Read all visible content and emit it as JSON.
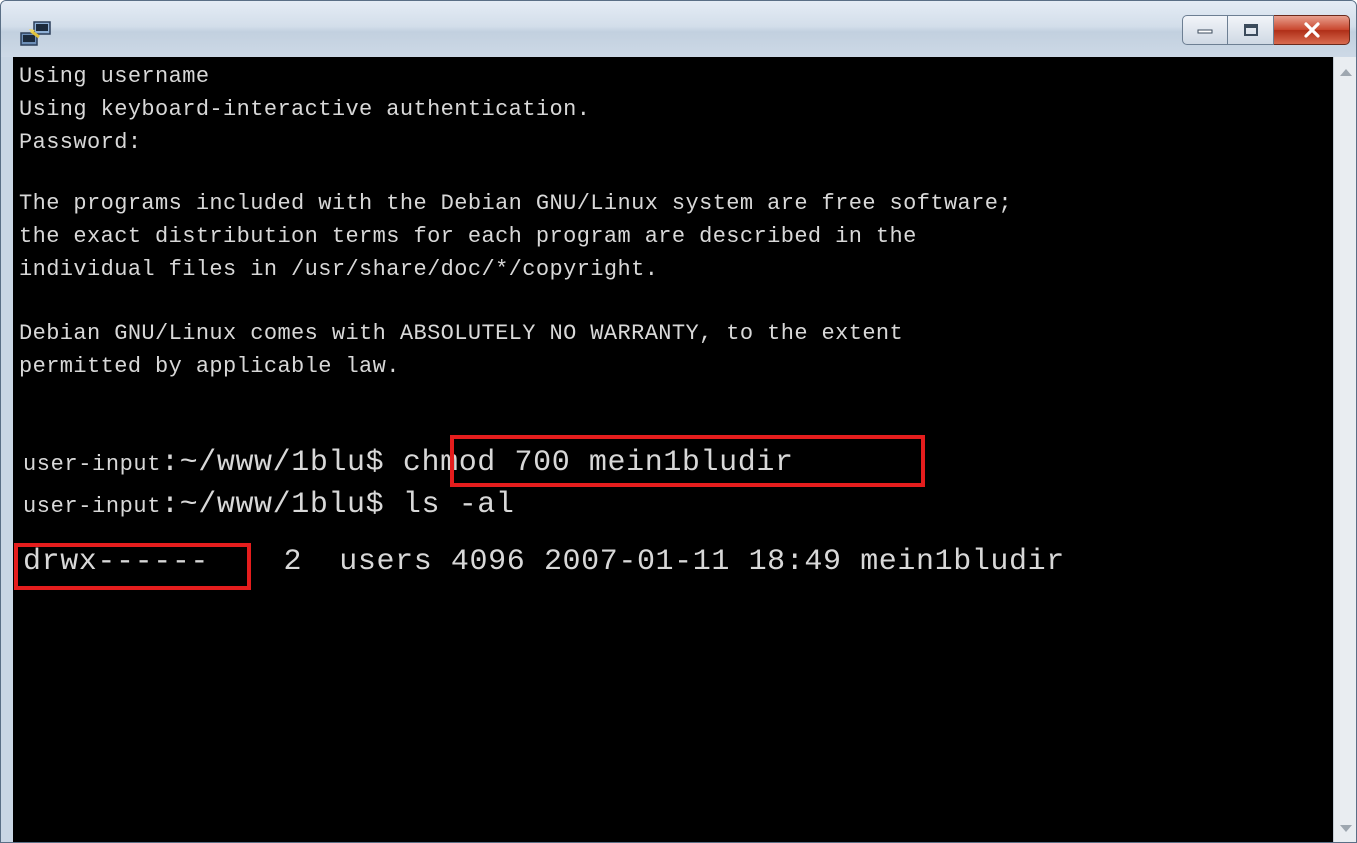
{
  "titlebar": {
    "icon": "putty-terminal-icon",
    "buttons": {
      "minimize_icon": "minimize-icon",
      "maximize_icon": "maximize-icon",
      "close_icon": "close-icon"
    }
  },
  "terminal": {
    "lines": [
      "Using username",
      "Using keyboard-interactive authentication.",
      "Password:",
      "The programs included with the Debian GNU/Linux system are free software;",
      "the exact distribution terms for each program are described in the",
      "individual files in /usr/share/doc/*/copyright.",
      "Debian GNU/Linux comes with ABSOLUTELY NO WARRANTY, to the extent",
      "permitted by applicable law."
    ],
    "prompt1": {
      "user": "user-input",
      "path": ":~/www/1blu$",
      "command": "chmod 700 mein1bludir"
    },
    "prompt2": {
      "user": "user-input",
      "path": ":~/www/1blu$",
      "command": "ls -al"
    },
    "listing": {
      "permissions": "drwx------",
      "links": "2",
      "group": "users",
      "size": "4096",
      "date": "2007-01-11",
      "time": "18:49",
      "name": "mein1bludir"
    }
  },
  "colors": {
    "terminal_bg": "#000000",
    "terminal_fg": "#d8d8d8",
    "highlight": "#e51d1d"
  }
}
